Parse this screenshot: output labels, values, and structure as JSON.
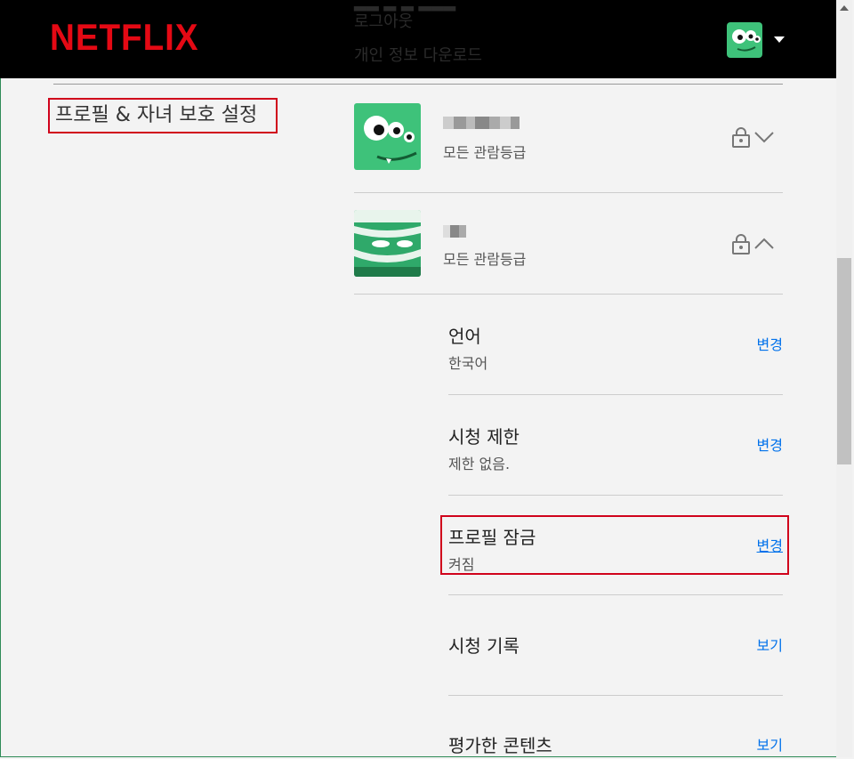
{
  "header": {
    "logo": "NETFLIX",
    "ghost_lines": [
      "로그아웃",
      "개인 정보 다운로드"
    ]
  },
  "section_title": "프로필 & 자녀 보호 설정",
  "profiles": [
    {
      "rating": "모든 관람등급",
      "lock_icon": "lock-icon",
      "toggle_icon": "chevron-down-icon"
    },
    {
      "rating": "모든 관람등급",
      "lock_icon": "lock-icon",
      "toggle_icon": "chevron-up-icon"
    }
  ],
  "settings": [
    {
      "title": "언어",
      "value": "한국어",
      "action": "변경"
    },
    {
      "title": "시청 제한",
      "value": "제한 없음.",
      "action": "변경"
    },
    {
      "title": "프로필 잠금",
      "value": "켜짐",
      "action": "변경"
    },
    {
      "title": "시청 기록",
      "value": "",
      "action": "보기"
    },
    {
      "title": "평가한 콘텐츠",
      "value": "",
      "action": "보기"
    }
  ],
  "colors": {
    "brand": "#e50914",
    "link": "#0071eb",
    "highlight": "#d0021b",
    "avatar_green": "#3ec27a"
  }
}
